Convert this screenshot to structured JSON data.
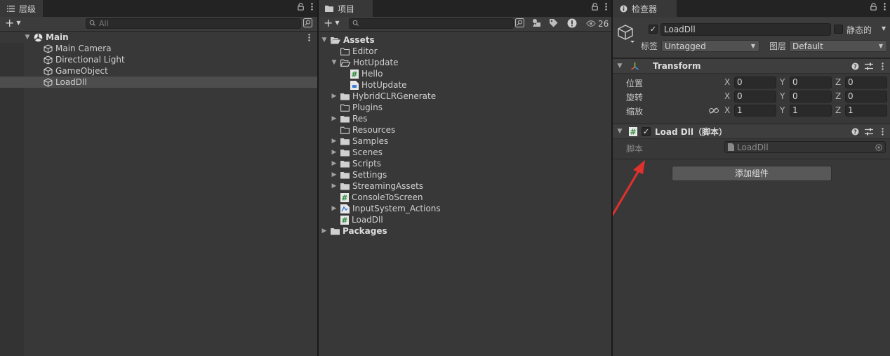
{
  "hierarchy": {
    "tab_label": "层级",
    "search_placeholder": "All",
    "scene_name": "Main",
    "items": [
      {
        "label": "Main Camera"
      },
      {
        "label": "Directional Light"
      },
      {
        "label": "GameObject"
      },
      {
        "label": "LoadDll"
      }
    ]
  },
  "project": {
    "tab_label": "项目",
    "search_placeholder": "",
    "hidden_count": "26",
    "tree": [
      {
        "label": "Assets",
        "bold": true
      },
      {
        "label": "Editor"
      },
      {
        "label": "HotUpdate"
      },
      {
        "label": "Hello"
      },
      {
        "label": "HotUpdate"
      },
      {
        "label": "HybridCLRGenerate"
      },
      {
        "label": "Plugins"
      },
      {
        "label": "Res"
      },
      {
        "label": "Resources"
      },
      {
        "label": "Samples"
      },
      {
        "label": "Scenes"
      },
      {
        "label": "Scripts"
      },
      {
        "label": "Settings"
      },
      {
        "label": "StreamingAssets"
      },
      {
        "label": "ConsoleToScreen"
      },
      {
        "label": "InputSystem_Actions"
      },
      {
        "label": "LoadDll"
      },
      {
        "label": "Packages",
        "bold": true
      }
    ]
  },
  "inspector": {
    "tab_label": "检查器",
    "object_name": "LoadDll",
    "static_label": "静态的",
    "tag_label": "标签",
    "tag_value": "Untagged",
    "layer_label": "图层",
    "layer_value": "Default",
    "transform": {
      "title": "Transform",
      "position_label": "位置",
      "rotation_label": "旋转",
      "scale_label": "缩放",
      "axis_x": "X",
      "axis_y": "Y",
      "axis_z": "Z",
      "position": [
        "0",
        "0",
        "0"
      ],
      "rotation": [
        "0",
        "0",
        "0"
      ],
      "scale": [
        "1",
        "1",
        "1"
      ]
    },
    "script_component": {
      "title": "Load Dll（脚本）",
      "script_label": "脚本",
      "script_value": "LoadDll"
    },
    "add_component_label": "添加组件",
    "annotation_color": "#e0312d"
  }
}
